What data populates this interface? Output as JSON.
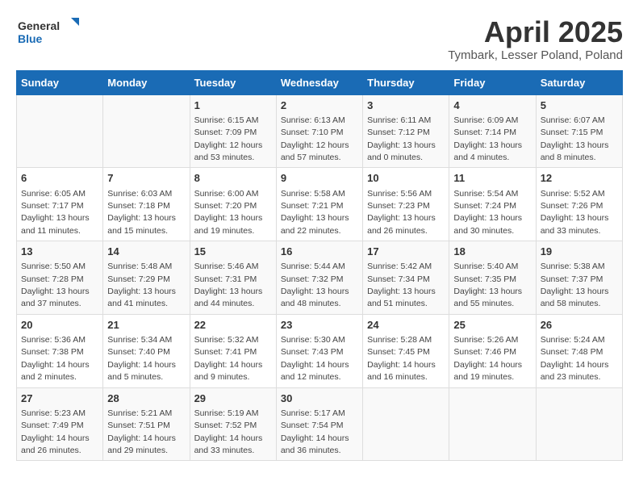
{
  "header": {
    "logo_general": "General",
    "logo_blue": "Blue",
    "title": "April 2025",
    "subtitle": "Tymbark, Lesser Poland, Poland"
  },
  "calendar": {
    "columns": [
      "Sunday",
      "Monday",
      "Tuesday",
      "Wednesday",
      "Thursday",
      "Friday",
      "Saturday"
    ],
    "weeks": [
      {
        "cells": [
          {
            "day": "",
            "info": ""
          },
          {
            "day": "",
            "info": ""
          },
          {
            "day": "1",
            "info": "Sunrise: 6:15 AM\nSunset: 7:09 PM\nDaylight: 12 hours\nand 53 minutes."
          },
          {
            "day": "2",
            "info": "Sunrise: 6:13 AM\nSunset: 7:10 PM\nDaylight: 12 hours\nand 57 minutes."
          },
          {
            "day": "3",
            "info": "Sunrise: 6:11 AM\nSunset: 7:12 PM\nDaylight: 13 hours\nand 0 minutes."
          },
          {
            "day": "4",
            "info": "Sunrise: 6:09 AM\nSunset: 7:14 PM\nDaylight: 13 hours\nand 4 minutes."
          },
          {
            "day": "5",
            "info": "Sunrise: 6:07 AM\nSunset: 7:15 PM\nDaylight: 13 hours\nand 8 minutes."
          }
        ]
      },
      {
        "cells": [
          {
            "day": "6",
            "info": "Sunrise: 6:05 AM\nSunset: 7:17 PM\nDaylight: 13 hours\nand 11 minutes."
          },
          {
            "day": "7",
            "info": "Sunrise: 6:03 AM\nSunset: 7:18 PM\nDaylight: 13 hours\nand 15 minutes."
          },
          {
            "day": "8",
            "info": "Sunrise: 6:00 AM\nSunset: 7:20 PM\nDaylight: 13 hours\nand 19 minutes."
          },
          {
            "day": "9",
            "info": "Sunrise: 5:58 AM\nSunset: 7:21 PM\nDaylight: 13 hours\nand 22 minutes."
          },
          {
            "day": "10",
            "info": "Sunrise: 5:56 AM\nSunset: 7:23 PM\nDaylight: 13 hours\nand 26 minutes."
          },
          {
            "day": "11",
            "info": "Sunrise: 5:54 AM\nSunset: 7:24 PM\nDaylight: 13 hours\nand 30 minutes."
          },
          {
            "day": "12",
            "info": "Sunrise: 5:52 AM\nSunset: 7:26 PM\nDaylight: 13 hours\nand 33 minutes."
          }
        ]
      },
      {
        "cells": [
          {
            "day": "13",
            "info": "Sunrise: 5:50 AM\nSunset: 7:28 PM\nDaylight: 13 hours\nand 37 minutes."
          },
          {
            "day": "14",
            "info": "Sunrise: 5:48 AM\nSunset: 7:29 PM\nDaylight: 13 hours\nand 41 minutes."
          },
          {
            "day": "15",
            "info": "Sunrise: 5:46 AM\nSunset: 7:31 PM\nDaylight: 13 hours\nand 44 minutes."
          },
          {
            "day": "16",
            "info": "Sunrise: 5:44 AM\nSunset: 7:32 PM\nDaylight: 13 hours\nand 48 minutes."
          },
          {
            "day": "17",
            "info": "Sunrise: 5:42 AM\nSunset: 7:34 PM\nDaylight: 13 hours\nand 51 minutes."
          },
          {
            "day": "18",
            "info": "Sunrise: 5:40 AM\nSunset: 7:35 PM\nDaylight: 13 hours\nand 55 minutes."
          },
          {
            "day": "19",
            "info": "Sunrise: 5:38 AM\nSunset: 7:37 PM\nDaylight: 13 hours\nand 58 minutes."
          }
        ]
      },
      {
        "cells": [
          {
            "day": "20",
            "info": "Sunrise: 5:36 AM\nSunset: 7:38 PM\nDaylight: 14 hours\nand 2 minutes."
          },
          {
            "day": "21",
            "info": "Sunrise: 5:34 AM\nSunset: 7:40 PM\nDaylight: 14 hours\nand 5 minutes."
          },
          {
            "day": "22",
            "info": "Sunrise: 5:32 AM\nSunset: 7:41 PM\nDaylight: 14 hours\nand 9 minutes."
          },
          {
            "day": "23",
            "info": "Sunrise: 5:30 AM\nSunset: 7:43 PM\nDaylight: 14 hours\nand 12 minutes."
          },
          {
            "day": "24",
            "info": "Sunrise: 5:28 AM\nSunset: 7:45 PM\nDaylight: 14 hours\nand 16 minutes."
          },
          {
            "day": "25",
            "info": "Sunrise: 5:26 AM\nSunset: 7:46 PM\nDaylight: 14 hours\nand 19 minutes."
          },
          {
            "day": "26",
            "info": "Sunrise: 5:24 AM\nSunset: 7:48 PM\nDaylight: 14 hours\nand 23 minutes."
          }
        ]
      },
      {
        "cells": [
          {
            "day": "27",
            "info": "Sunrise: 5:23 AM\nSunset: 7:49 PM\nDaylight: 14 hours\nand 26 minutes."
          },
          {
            "day": "28",
            "info": "Sunrise: 5:21 AM\nSunset: 7:51 PM\nDaylight: 14 hours\nand 29 minutes."
          },
          {
            "day": "29",
            "info": "Sunrise: 5:19 AM\nSunset: 7:52 PM\nDaylight: 14 hours\nand 33 minutes."
          },
          {
            "day": "30",
            "info": "Sunrise: 5:17 AM\nSunset: 7:54 PM\nDaylight: 14 hours\nand 36 minutes."
          },
          {
            "day": "",
            "info": ""
          },
          {
            "day": "",
            "info": ""
          },
          {
            "day": "",
            "info": ""
          }
        ]
      }
    ]
  }
}
